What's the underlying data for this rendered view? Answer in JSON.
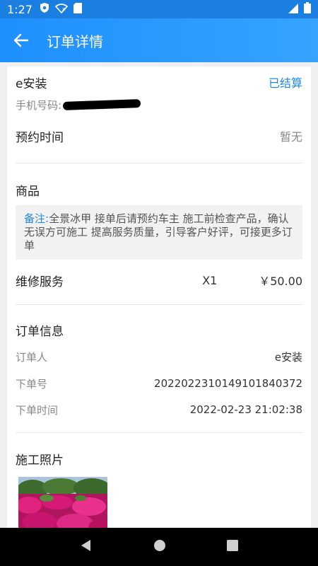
{
  "status_bar": {
    "time": "1:27"
  },
  "header": {
    "title": "订单详情"
  },
  "customer": {
    "name": "e安装",
    "status": "已结算",
    "phone_label": "手机号码:"
  },
  "appointment": {
    "label": "预约时间",
    "value": "暂无"
  },
  "goods": {
    "section_title": "商品",
    "note_label": "备注:",
    "note_text": "全景冰甲 接单后请预约车主 施工前检查产品，确认无误方可施工 提高服务质量，引导客户好评，可接更多订单",
    "item_name": "维修服务",
    "item_qty": "X1",
    "item_price": "￥50.00"
  },
  "order_info": {
    "section_title": "订单信息",
    "orderer_label": "订单人",
    "orderer_value": "e安装",
    "order_no_label": "下单号",
    "order_no_value": "20220223101491018403​72",
    "order_time_label": "下单时间",
    "order_time_value": "2022-02-23 21:02:38"
  },
  "photos": {
    "section_title": "施工照片"
  },
  "colors": {
    "accent": "#1e88e5",
    "header": "#1e90ff"
  }
}
